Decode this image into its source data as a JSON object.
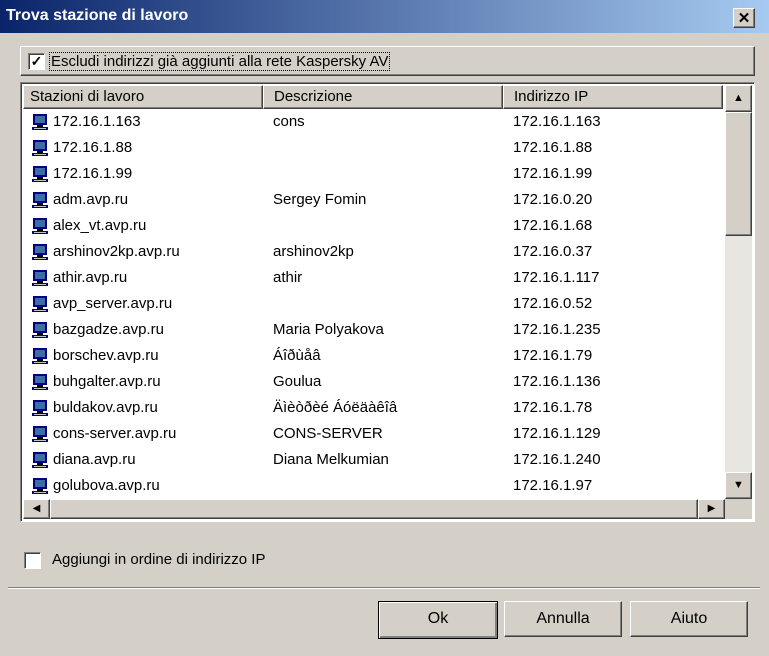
{
  "window": {
    "title": "Trova stazione di lavoro",
    "close_glyph": "✕"
  },
  "exclude_option": {
    "checked": true,
    "label": "Escludi indirizzi già aggiunti alla rete Kaspersky AV"
  },
  "list": {
    "columns": [
      "Stazioni di lavoro",
      "Descrizione",
      "Indirizzo IP"
    ],
    "rows": [
      {
        "name": "172.16.1.163",
        "description": "cons",
        "ip": "172.16.1.163"
      },
      {
        "name": "172.16.1.88",
        "description": "",
        "ip": "172.16.1.88"
      },
      {
        "name": "172.16.1.99",
        "description": "",
        "ip": "172.16.1.99"
      },
      {
        "name": "adm.avp.ru",
        "description": "Sergey Fomin",
        "ip": "172.16.0.20"
      },
      {
        "name": "alex_vt.avp.ru",
        "description": "",
        "ip": "172.16.1.68"
      },
      {
        "name": "arshinov2kp.avp.ru",
        "description": "arshinov2kp",
        "ip": "172.16.0.37"
      },
      {
        "name": "athir.avp.ru",
        "description": "athir",
        "ip": "172.16.1.117"
      },
      {
        "name": "avp_server.avp.ru",
        "description": "",
        "ip": "172.16.0.52"
      },
      {
        "name": "bazgadze.avp.ru",
        "description": "Maria Polyakova",
        "ip": "172.16.1.235"
      },
      {
        "name": "borschev.avp.ru",
        "description": "Áîðùåâ",
        "ip": "172.16.1.79"
      },
      {
        "name": "buhgalter.avp.ru",
        "description": "Goulua",
        "ip": "172.16.1.136"
      },
      {
        "name": "buldakov.avp.ru",
        "description": "Äìèòðèé Áóëäàêîâ",
        "ip": "172.16.1.78"
      },
      {
        "name": "cons-server.avp.ru",
        "description": "CONS-SERVER",
        "ip": "172.16.1.129"
      },
      {
        "name": "diana.avp.ru",
        "description": "Diana Melkumian",
        "ip": "172.16.1.240"
      },
      {
        "name": "golubova.avp.ru",
        "description": "",
        "ip": "172.16.1.97"
      }
    ],
    "row_icon": "computer-icon",
    "scroll_up_glyph": "▲",
    "scroll_down_glyph": "▼",
    "scroll_left_glyph": "◀",
    "scroll_right_glyph": "▶"
  },
  "sort_option": {
    "checked": false,
    "label": "Aggiungi in ordine di indirizzo IP"
  },
  "buttons": {
    "ok": "Ok",
    "cancel": "Annulla",
    "help": "Aiuto"
  },
  "colors": {
    "title_start": "#0a246a",
    "title_end": "#a6caf0",
    "face": "#d4d0c8"
  }
}
